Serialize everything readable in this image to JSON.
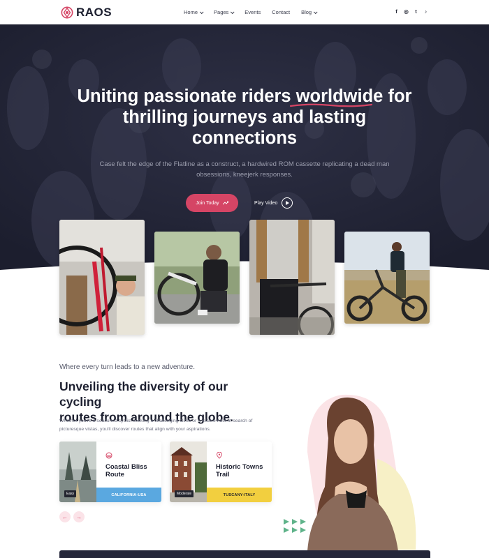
{
  "brand": {
    "name": "RAOS",
    "accent": "#d54565",
    "dark": "#24263a"
  },
  "nav": {
    "items": [
      {
        "label": "Home",
        "dropdown": true
      },
      {
        "label": "Pages",
        "dropdown": true
      },
      {
        "label": "Events",
        "dropdown": false
      },
      {
        "label": "Contact",
        "dropdown": false
      },
      {
        "label": "Blog",
        "dropdown": true
      }
    ],
    "social": [
      {
        "icon": "facebook-icon",
        "glyph": "f"
      },
      {
        "icon": "instagram-icon",
        "glyph": "◎"
      },
      {
        "icon": "twitter-icon",
        "glyph": "t"
      },
      {
        "icon": "tiktok-icon",
        "glyph": "♪"
      }
    ]
  },
  "hero": {
    "title_part1": "Uniting passionate riders ",
    "title_highlight": "worldwide",
    "title_part2": " for",
    "title_line2": "thrilling journeys and lasting",
    "title_line3": "connections",
    "subtitle_line1": "Case felt the edge of the Flatline as a construct, a hardwired ROM cassette replicating a dead man",
    "subtitle_line2": "obsessions, kneejerk responses.",
    "join_label": "Join Today",
    "play_label": "Play Video"
  },
  "routes": {
    "eyebrow": "Where every turn leads to a new adventure.",
    "title_line1": "Unveiling the diversity of our cycling",
    "title_line2": "routes from around the globe.",
    "desc_line1": "Whether you're a seasoned cyclist seeking a challenging climb or a leisure rider in search of",
    "desc_line2": "picturesque vistas, you'll discover routes that align with your aspirations.",
    "cards": [
      {
        "title": "Coastal Bliss Route",
        "badge": "Easy",
        "location": "CALIFORNIA-USA",
        "band_color": "#5aa8e0",
        "band_text_color": "#ffffff",
        "icon": "bike-icon"
      },
      {
        "title": "Historic Towns Trail",
        "badge": "Moderate",
        "location": "TUSCANY-ITALY",
        "band_color": "#f2cf3f",
        "band_text_color": "#2a2a2a",
        "icon": "map-pin-icon"
      }
    ],
    "prev_glyph": "←",
    "next_glyph": "→"
  }
}
